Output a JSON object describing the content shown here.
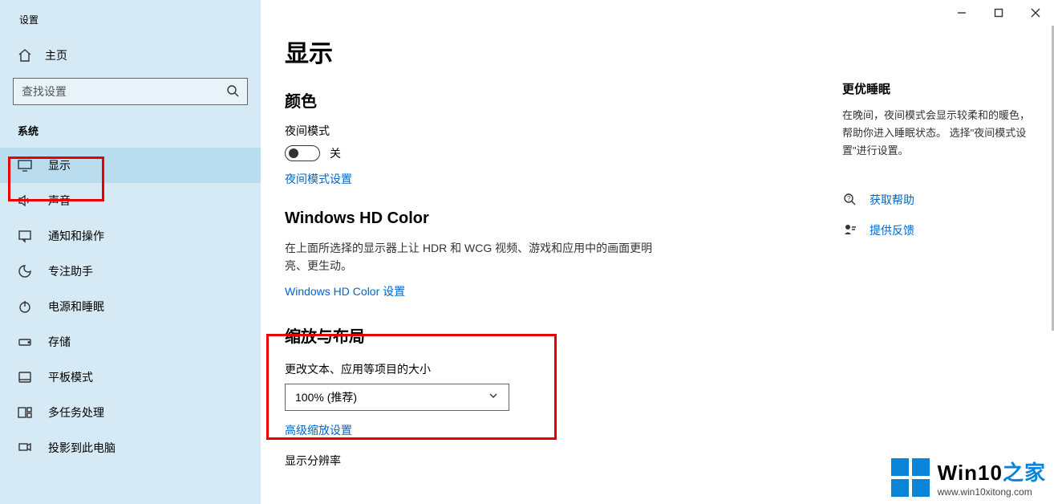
{
  "app_title": "设置",
  "home_label": "主页",
  "search_placeholder": "查找设置",
  "section_label": "系统",
  "nav": [
    {
      "label": "显示"
    },
    {
      "label": "声音"
    },
    {
      "label": "通知和操作"
    },
    {
      "label": "专注助手"
    },
    {
      "label": "电源和睡眠"
    },
    {
      "label": "存储"
    },
    {
      "label": "平板模式"
    },
    {
      "label": "多任务处理"
    },
    {
      "label": "投影到此电脑"
    }
  ],
  "page_title": "显示",
  "color": {
    "heading": "颜色",
    "night_mode_label": "夜间模式",
    "toggle_state": "关",
    "settings_link": "夜间模式设置"
  },
  "hd": {
    "heading": "Windows HD Color",
    "desc": "在上面所选择的显示器上让 HDR 和 WCG 视频、游戏和应用中的画面更明亮、更生动。",
    "link": "Windows HD Color 设置"
  },
  "scale": {
    "heading": "缩放与布局",
    "size_label": "更改文本、应用等项目的大小",
    "dropdown_value": "100% (推荐)",
    "advanced_link": "高级缩放设置",
    "resolution_label": "显示分辨率"
  },
  "right": {
    "heading": "更优睡眠",
    "desc": "在晚间，夜间模式会显示较柔和的暖色，帮助你进入睡眠状态。 选择\"夜间模式设置\"进行设置。",
    "help": "获取帮助",
    "feedback": "提供反馈"
  },
  "watermark": {
    "title_en": "Win10",
    "title_zh": "之家",
    "url": "www.win10xitong.com"
  }
}
